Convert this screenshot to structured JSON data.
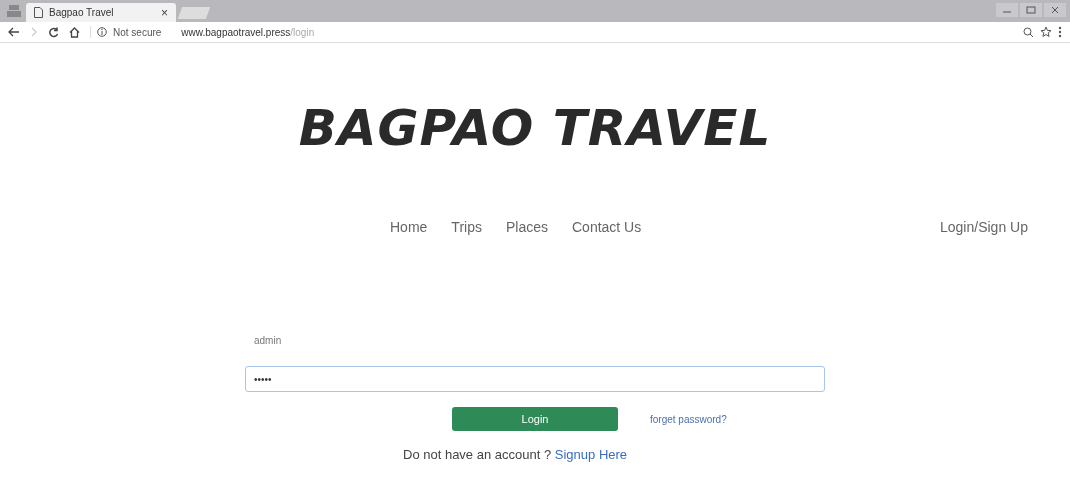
{
  "browser": {
    "tab_title": "Bagpao Travel",
    "tab_close": "×",
    "security": "Not secure",
    "url_host": "www.bagpaotravel.press",
    "url_path": "/login"
  },
  "logo": "BAGPAO TRAVEL",
  "nav": {
    "items": [
      "Home",
      "Trips",
      "Places",
      "Contact Us"
    ],
    "account_link": "Login/Sign Up"
  },
  "form": {
    "username": {
      "value": "admin",
      "focused": false
    },
    "password": {
      "value": "•••••",
      "focused": true
    },
    "login_button": "Login",
    "forgot_link": "forget password?",
    "signup_prompt": "Do not have an account ?",
    "signup_link": "Signup Here"
  }
}
